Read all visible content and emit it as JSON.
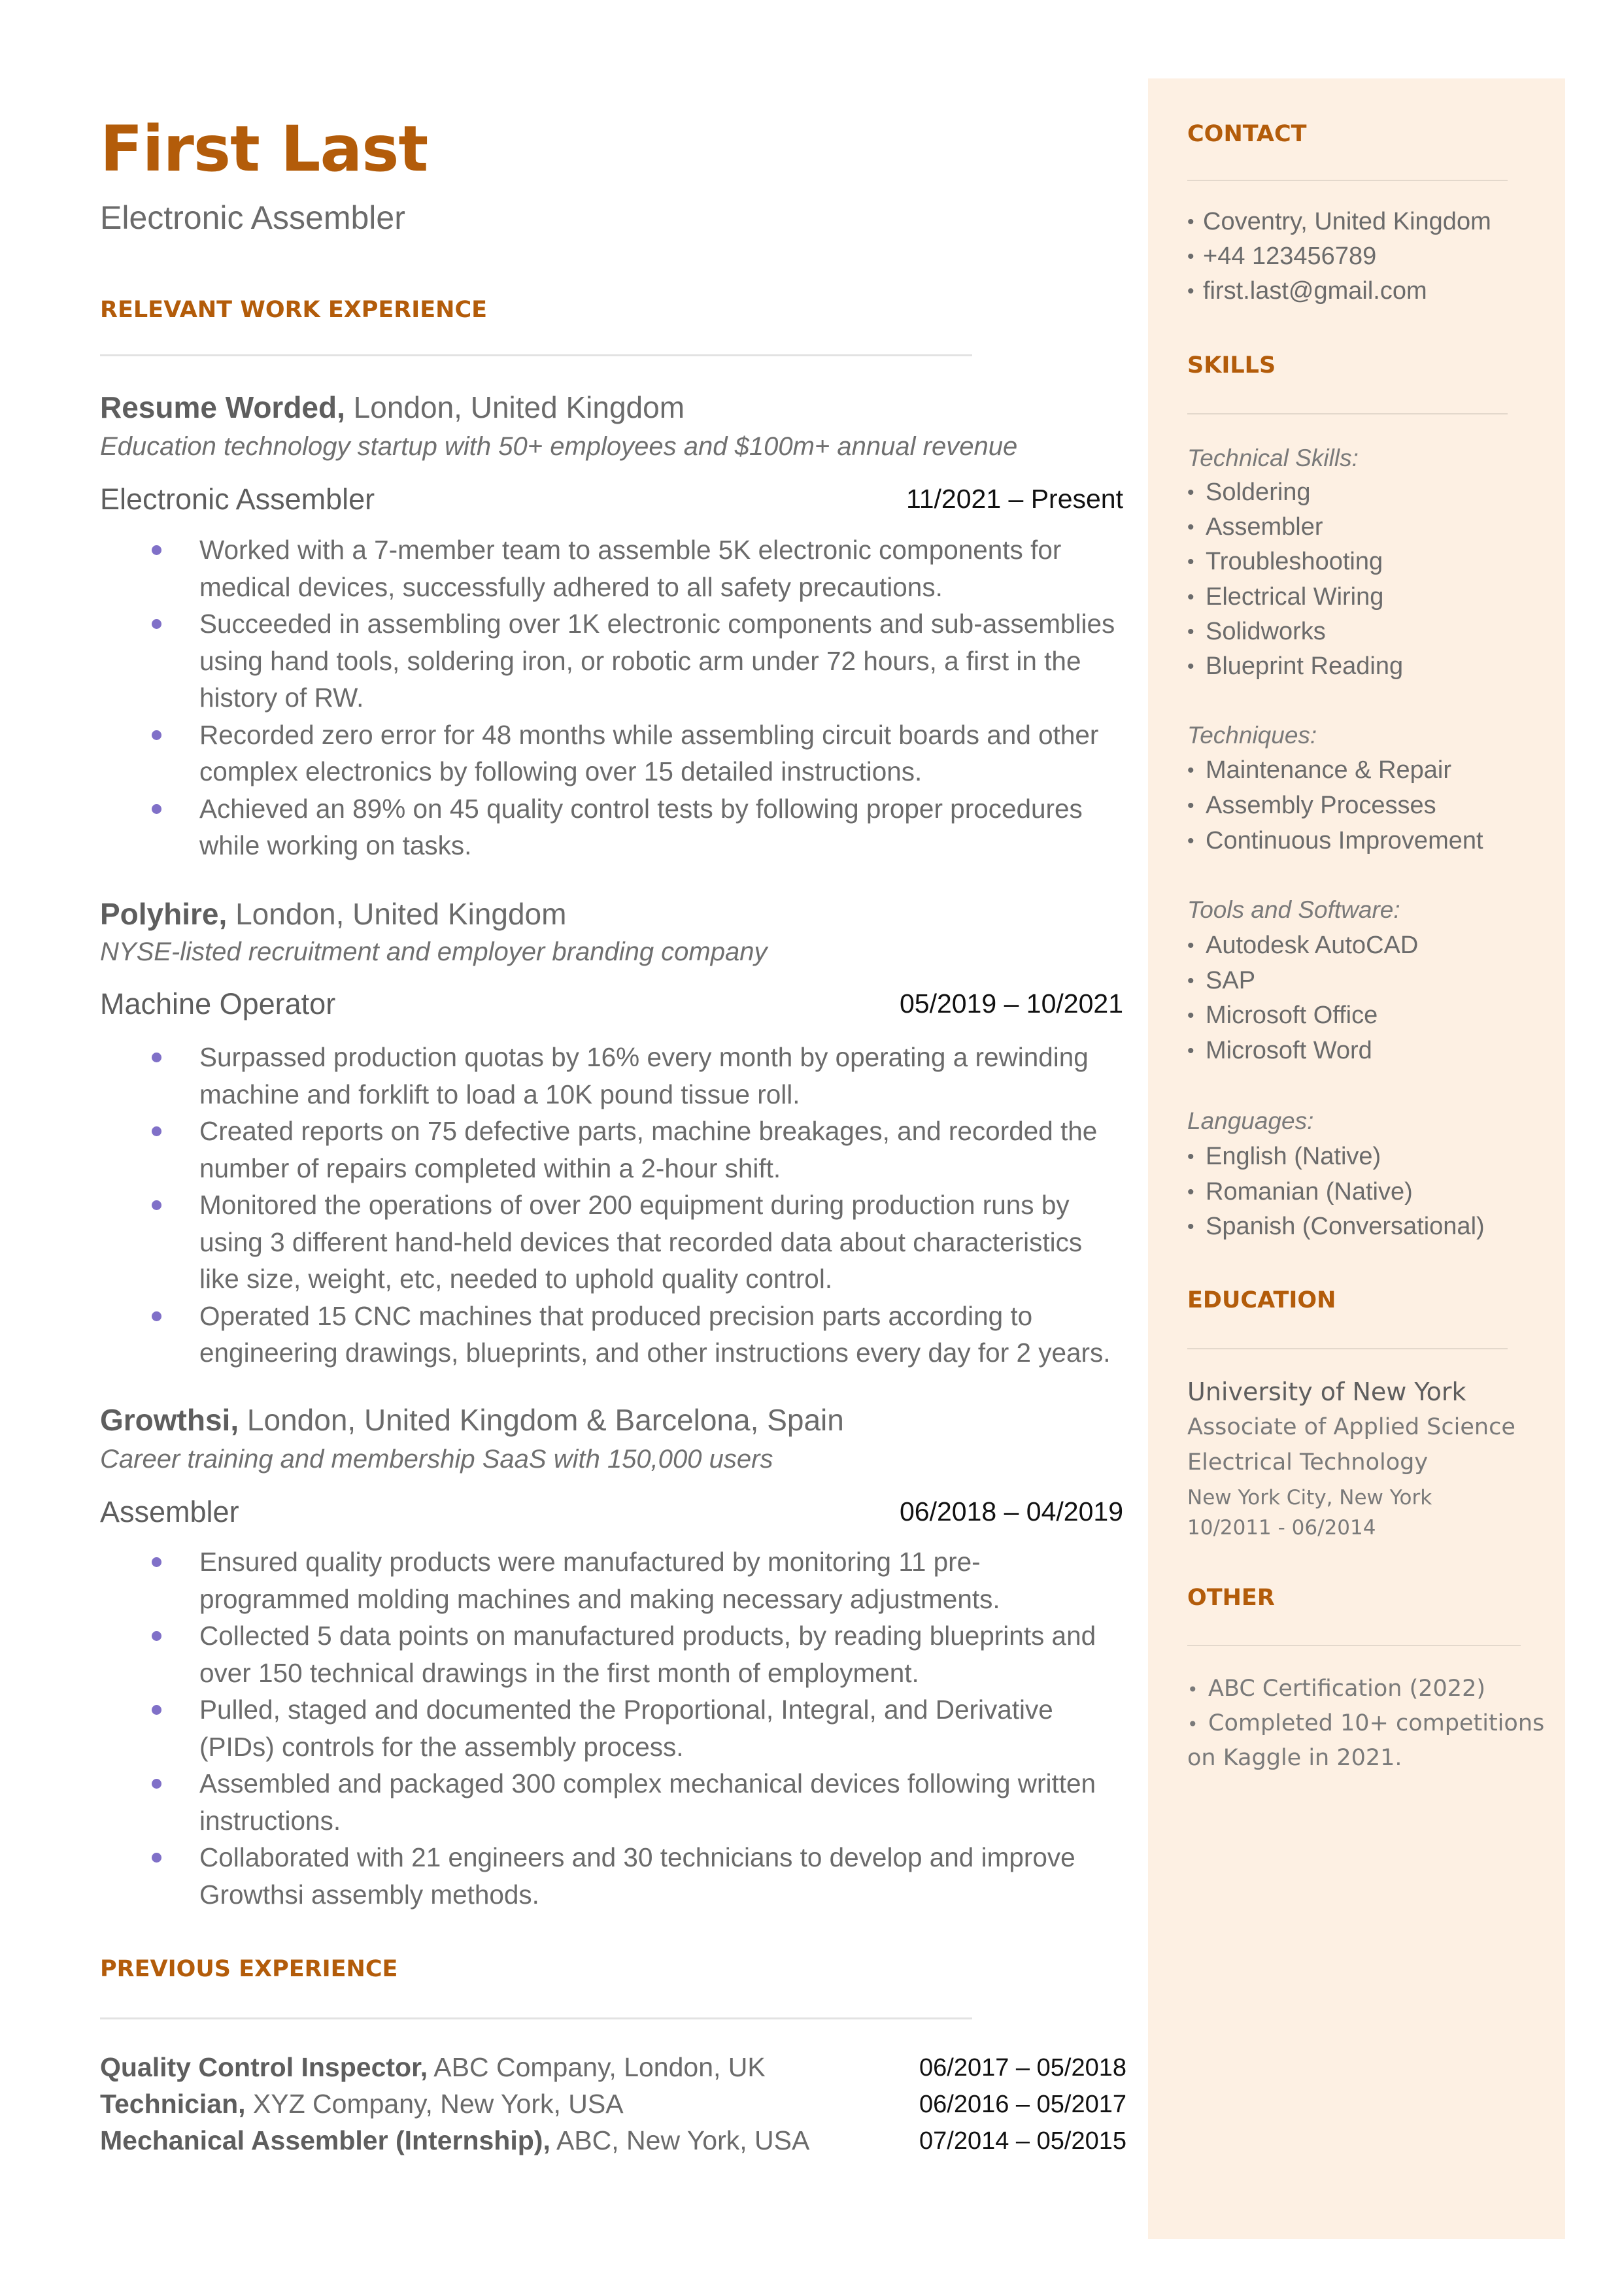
{
  "header": {
    "name": "First Last",
    "title": "Electronic Assembler"
  },
  "colors": {
    "accent": "#b35c0a",
    "sidebar_bg": "#fdf0e3",
    "bullet": "#8070c8"
  },
  "sections": {
    "relevant_work": "RELEVANT WORK EXPERIENCE",
    "previous": "PREVIOUS EXPERIENCE",
    "contact": "CONTACT",
    "skills": "SKILLS",
    "education": "EDUCATION",
    "other": "OTHER"
  },
  "jobs": [
    {
      "company": "Resume Worded,",
      "location": " London, United Kingdom",
      "description": "Education technology startup with 50+ employees and $100m+ annual revenue",
      "role": "Electronic Assembler",
      "dates": "11/2021 – Present",
      "bullets": [
        "Worked with a 7-member team to assemble 5K electronic components for medical devices, successfully adhered to all safety precautions.",
        "Succeeded in assembling  over 1K electronic components and sub-assemblies using hand tools, soldering iron, or robotic arm under 72 hours, a first in the history of RW.",
        "Recorded zero error for 48 months while assembling circuit boards and other complex electronics by following over 15 detailed instructions.",
        "Achieved an 89% on 45 quality control tests by following proper procedures while working on tasks."
      ]
    },
    {
      "company": "Polyhire,",
      "location": " London, United Kingdom",
      "description": "NYSE-listed recruitment and employer branding company",
      "role": "Machine Operator",
      "dates": "05/2019 – 10/2021",
      "bullets": [
        "Surpassed production quotas by 16% every month by operating a rewinding machine and forklift to load a 10K pound tissue roll.",
        "Created reports on 75 defective parts, machine breakages, and recorded the number of repairs completed within a 2-hour shift.",
        "Monitored the operations of over 200 equipment during production runs by using 3 different hand-held devices that recorded data about characteristics like size, weight, etc, needed to uphold quality control.",
        "Operated 15 CNC machines that produced precision parts according to engineering drawings, blueprints, and other instructions every day for 2 years."
      ]
    },
    {
      "company": "Growthsi,",
      "location": " London, United Kingdom & Barcelona, Spain",
      "description": "Career training and membership SaaS with 150,000 users",
      "role": "Assembler",
      "dates": "06/2018 – 04/2019",
      "bullets": [
        "Ensured quality products were manufactured by monitoring 11 pre-programmed molding machines and making necessary adjustments.",
        "Collected 5 data points on manufactured products, by reading blueprints and over 150 technical drawings in the first month of employment.",
        "Pulled, staged and documented the Proportional, Integral, and Derivative (PIDs) controls for the assembly process.",
        "Assembled and packaged 300 complex mechanical devices following written instructions.",
        "Collaborated with 21 engineers and 30 technicians to develop and improve Growthsi assembly methods."
      ]
    }
  ],
  "previous": [
    {
      "role": "Quality Control Inspector,",
      "org": " ABC Company, London, UK",
      "dates": "06/2017 – 05/2018"
    },
    {
      "role": "Technician,",
      "org": " XYZ Company, New York, USA",
      "dates": "06/2016 – 05/2017"
    },
    {
      "role": "Mechanical Assembler (Internship),",
      "org": " ABC, New York, USA",
      "dates": "07/2014 – 05/2015"
    }
  ],
  "contact": {
    "items": [
      "Coventry, United Kingdom",
      "+44 123456789",
      "first.last@gmail.com"
    ]
  },
  "skills": {
    "groups": [
      {
        "label": "Technical Skills:",
        "items": [
          "Soldering",
          "Assembler",
          "Troubleshooting",
          "Electrical Wiring",
          "Solidworks",
          "Blueprint Reading"
        ]
      },
      {
        "label": "Techniques:",
        "items": [
          "Maintenance & Repair",
          "Assembly Processes",
          "Continuous Improvement"
        ]
      },
      {
        "label": "Tools and Software:",
        "items": [
          "Autodesk AutoCAD",
          "SAP",
          "Microsoft Office",
          "Microsoft Word"
        ]
      },
      {
        "label": "Languages:",
        "items": [
          "English (Native)",
          "Romanian (Native)",
          "Spanish (Conversational)"
        ]
      }
    ]
  },
  "education": {
    "school": "University of New York",
    "degree": "Associate of Applied Science",
    "field": "Electrical Technology",
    "location": "New York City, New York",
    "dates": "10/2011 - 06/2014"
  },
  "other": {
    "items": [
      "ABC Certification (2022)",
      "Completed 10+ competitions"
    ],
    "continuation": "on Kaggle in 2021."
  },
  "bullet_glyph": "•"
}
